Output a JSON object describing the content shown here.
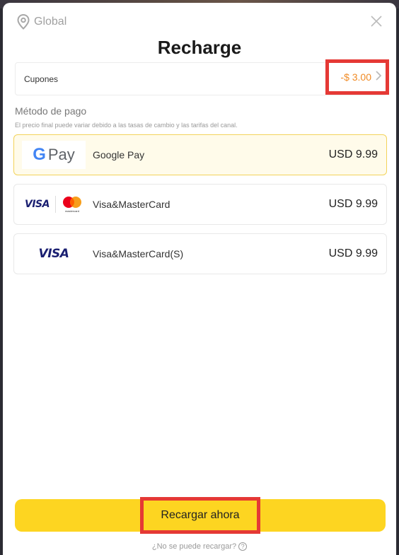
{
  "header": {
    "region": "Global",
    "title": "Recharge"
  },
  "coupon": {
    "label": "Cupones",
    "value": "-$ 3.00"
  },
  "payment": {
    "section_title": "Método de pago",
    "note": "El precio final puede variar debido a las tasas de cambio y las tarifas del canal.",
    "methods": [
      {
        "name": "Google Pay",
        "price": "USD 9.99",
        "logo_icon": "google-pay-logo",
        "logo_text": {
          "g": "G",
          "pay": "Pay"
        },
        "selected": true
      },
      {
        "name": "Visa&MasterCard",
        "price": "USD 9.99",
        "logo_icon": "visa-mastercard-logo",
        "logo_text": {
          "visa": "VISA",
          "mc": "mastercard"
        },
        "selected": false
      },
      {
        "name": "Visa&MasterCard(S)",
        "price": "USD 9.99",
        "logo_icon": "visa-logo",
        "logo_text": {
          "visa": "VISA"
        },
        "selected": false
      }
    ]
  },
  "actions": {
    "recharge_label": "Recargar ahora",
    "help_text": "¿No se puede recargar?",
    "help_icon": "?"
  },
  "colors": {
    "accent": "#fdd521",
    "coupon": "#f08a24",
    "highlight": "#e53935",
    "selected_bg": "#fffbea"
  }
}
